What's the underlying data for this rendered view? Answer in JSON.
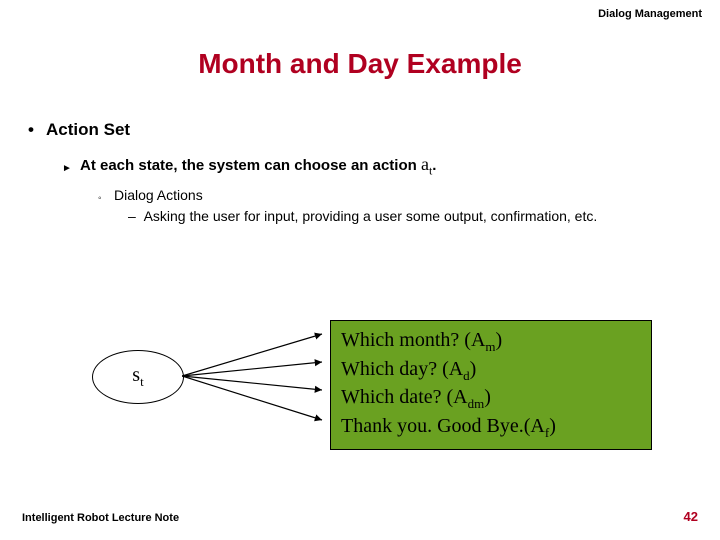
{
  "header": {
    "label": "Dialog Management"
  },
  "title": "Month and Day Example",
  "bullets": {
    "l1": "Action Set",
    "l2_pre": "At each state, the system can choose an action ",
    "l2_var": "a",
    "l2_sub": "t",
    "l2_post": ".",
    "l3": "Dialog Actions",
    "l4": "–  Asking the user for input, providing a user some output, confirmation, etc."
  },
  "state": {
    "s": "s",
    "t": "t"
  },
  "actions": {
    "line1_pre": "Which month? (A",
    "line1_sub": "m",
    "line1_post": ")",
    "line2_pre": "Which day? (A",
    "line2_sub": "d",
    "line2_post": ")",
    "line3_pre": "Which date? (A",
    "line3_sub": "dm",
    "line3_post": ")",
    "line4_pre": "Thank you. Good Bye.(A",
    "line4_sub": "f",
    "line4_post": ")"
  },
  "footer": {
    "left": "Intelligent Robot Lecture Note",
    "page": "42"
  }
}
